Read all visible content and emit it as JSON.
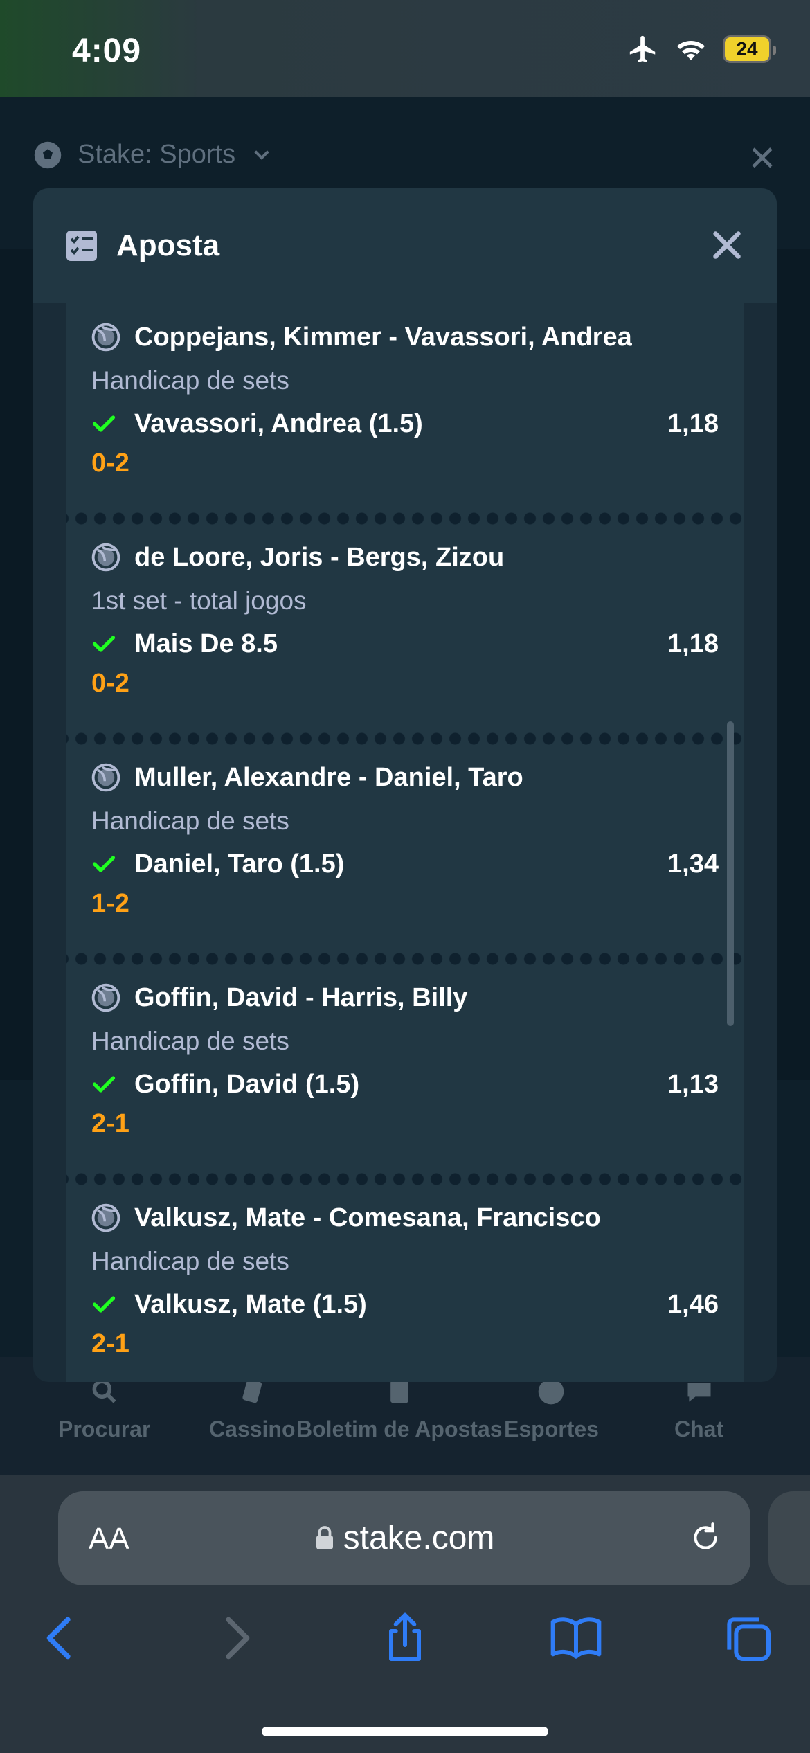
{
  "status_bar": {
    "time": "4:09",
    "battery": "24"
  },
  "page": {
    "sport_title": "Stake: Sports",
    "bottom_nav": [
      "Procurar",
      "Cassino",
      "Boletim de Apostas",
      "Esportes",
      "Chat"
    ]
  },
  "modal": {
    "title": "Aposta",
    "bets": [
      {
        "match": "Coppejans, Kimmer - Vavassori, Andrea",
        "market": "Handicap de sets",
        "selection": "Vavassori, Andrea (1.5)",
        "odds": "1,18",
        "score": "0-2"
      },
      {
        "match": "de Loore, Joris - Bergs, Zizou",
        "market": "1st set - total jogos",
        "selection": "Mais De 8.5",
        "odds": "1,18",
        "score": "0-2"
      },
      {
        "match": "Muller, Alexandre - Daniel, Taro",
        "market": "Handicap de sets",
        "selection": "Daniel, Taro (1.5)",
        "odds": "1,34",
        "score": "1-2"
      },
      {
        "match": "Goffin, David - Harris, Billy",
        "market": "Handicap de sets",
        "selection": "Goffin, David (1.5)",
        "odds": "1,13",
        "score": "2-1"
      },
      {
        "match": "Valkusz, Mate - Comesana, Francisco",
        "market": "Handicap de sets",
        "selection": "Valkusz, Mate (1.5)",
        "odds": "1,46",
        "score": "2-1"
      }
    ]
  },
  "browser": {
    "aa_label": "AA",
    "url": "stake.com"
  },
  "colors": {
    "accent_orange": "#ffa116",
    "check_green": "#1fff20",
    "modal_bg": "#213743",
    "safari_blue": "#2f7cf6"
  }
}
